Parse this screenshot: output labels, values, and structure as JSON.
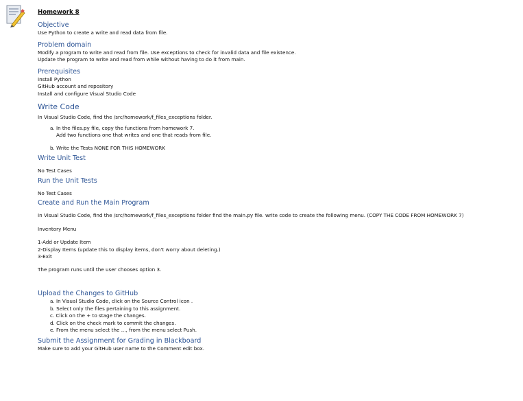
{
  "header": {
    "title": "Homework 8",
    "icon": "assignment-document-icon"
  },
  "objective": {
    "heading": "Objective",
    "text": "Use Python to create a write and read data from file."
  },
  "problem_domain": {
    "heading": "Problem domain",
    "lines": [
      "Modify a program to write and read from file. Use exceptions to check for invalid data and file existence.",
      "Update the program to write and read from while without having to do it from main."
    ]
  },
  "prerequisites": {
    "heading": "Prerequisites",
    "lines": [
      "Install Python",
      "GitHub account and repository",
      "Install and configure Visual Studio Code"
    ]
  },
  "write_code": {
    "heading": "Write Code",
    "intro": "In Visual Studio Code, find the /src/homework/f_files_exceptions folder.",
    "item_a_line1": "a. In the files.py file, copy the functions from homework 7.",
    "item_a_line2": "Add two functions one that writes and one that reads from file.",
    "item_b": "b. Write the Tests NONE FOR THIS HOMEWORK"
  },
  "write_unit_test": {
    "heading": "Write Unit Test",
    "text": "No Test Cases"
  },
  "run_unit_tests": {
    "heading": "Run the Unit Tests",
    "text": "No Test Cases"
  },
  "main_program": {
    "heading": "Create and Run the Main Program",
    "intro": "In Visual Studio Code, find the /src/homework/f_files_exceptions folder find the main.py file. write code to create the following menu. (COPY THE CODE FROM HOMEWORK 7)",
    "menu_title": "Inventory Menu",
    "menu_items": [
      "1-Add or Update Item",
      "2-Display Items (update this to display items, don't worry about deleting.)",
      "3-Exit"
    ],
    "footer": "The program runs until the user chooses option 3."
  },
  "upload": {
    "heading": "Upload the Changes to GitHub",
    "steps": [
      "a. In Visual Studio Code, click on the Source Control icon .",
      "b. Select only the files pertaining to this assignment.",
      "c. Click on the + to stage the changes.",
      "d. Click on the check mark to commit the changes.",
      "e. From the menu select the ..., from the menu select Push."
    ]
  },
  "submit": {
    "heading": "Submit the Assignment for Grading in Blackboard",
    "text": "Make sure to add your GitHub user name to the Comment edit box."
  }
}
